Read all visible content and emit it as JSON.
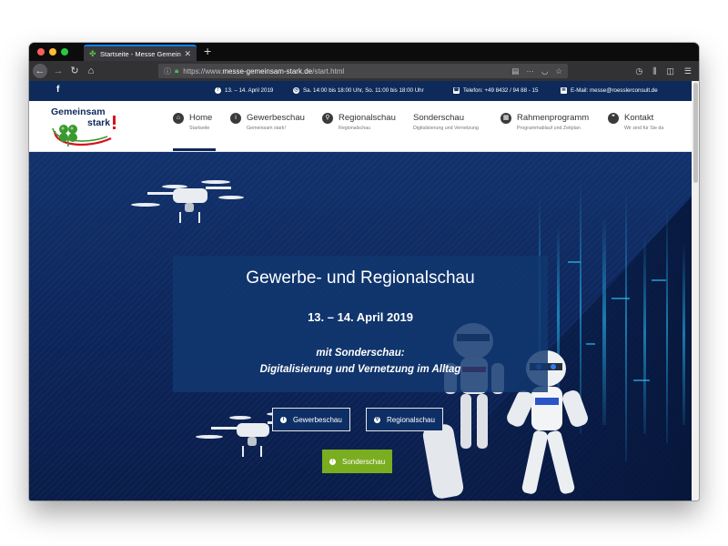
{
  "browser": {
    "tab_title": "Startseite - Messe Gemeinsam",
    "tab_close": "✕",
    "new_tab": "+",
    "url_prefix": "https://www.",
    "url_host": "messe-gemeinsam-stark.de",
    "url_path": "/start.html"
  },
  "topbar": {
    "facebook": "f",
    "date": "13. – 14. April 2019",
    "hours": "Sa. 14:00 bis 18:00 Uhr, So. 11:00 bis 18:00 Uhr",
    "phone": "Telefon: +49 8432 / 94 88 - 15",
    "email": "E-Mail: messe@roesslerconsult.de"
  },
  "logo": {
    "line1": "Gemeinsam",
    "line2": "stark"
  },
  "nav": [
    {
      "label": "Home",
      "sub": "Startseite",
      "icon": "home-icon"
    },
    {
      "label": "Gewerbeschau",
      "sub": "Gemeinsam stark!",
      "icon": "info-icon"
    },
    {
      "label": "Regionalschau",
      "sub": "Regionalschau",
      "icon": "map-pin-icon"
    },
    {
      "label": "Sonderschau",
      "sub": "Digitalisierung und Vernetzung",
      "icon": ""
    },
    {
      "label": "Rahmenprogramm",
      "sub": "Programmablauf und Zeitplan",
      "icon": "calendar-icon"
    },
    {
      "label": "Kontakt",
      "sub": "Wir sind für Sie da",
      "icon": "chat-icon"
    }
  ],
  "hero": {
    "title": "Gewerbe- und Regionalschau",
    "date": "13. – 14. April 2019",
    "sub1": "mit Sonderschau:",
    "sub2": "Digitalisierung und Vernetzung im Alltag",
    "btn_gewerbe": "Gewerbeschau",
    "btn_regional": "Regionalschau",
    "btn_sonder": "Sonderschau"
  },
  "colors": {
    "brand_blue": "#0d2a5a",
    "accent_green": "#7aad1f",
    "logo_red": "#d6121f",
    "logo_green": "#3a9a2f"
  }
}
